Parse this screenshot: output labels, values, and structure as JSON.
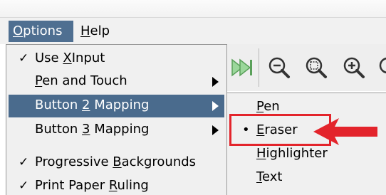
{
  "colors": {
    "menu_highlight": "#4a6b8d",
    "annotation_red": "#e3242b",
    "menu_background": "#f0f0f0"
  },
  "menubar": {
    "items": [
      {
        "label": "Options",
        "state": "open"
      },
      {
        "label": "Help",
        "state": "normal"
      }
    ]
  },
  "toolbar": {
    "icons": [
      "next-page-icon",
      "zoom-out-icon",
      "zoom-fit-icon",
      "zoom-in-icon"
    ]
  },
  "options_menu": {
    "items": [
      {
        "label": "Use XInput",
        "checked": true,
        "submenu": false
      },
      {
        "label": "Pen and Touch",
        "checked": false,
        "submenu": true
      },
      {
        "label": "Button 2 Mapping",
        "checked": false,
        "submenu": true,
        "highlighted": true
      },
      {
        "label": "Button 3 Mapping",
        "checked": false,
        "submenu": true
      },
      {
        "label": "Progressive Backgrounds",
        "checked": true,
        "submenu": false
      },
      {
        "label": "Print Paper Ruling",
        "checked": true,
        "submenu": false
      }
    ],
    "check_glyph": "✓"
  },
  "button2_submenu": {
    "items": [
      {
        "label": "Pen",
        "selected": false
      },
      {
        "label": "Eraser",
        "selected": true
      },
      {
        "label": "Highlighter",
        "selected": false
      },
      {
        "label": "Text",
        "selected": false
      }
    ],
    "bullet_glyph": "•"
  }
}
